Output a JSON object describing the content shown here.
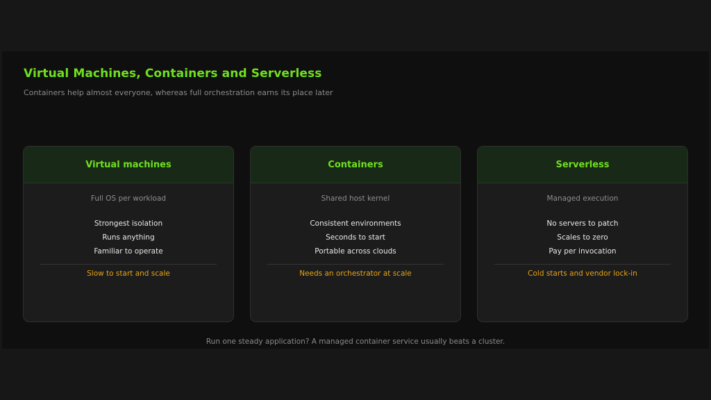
{
  "title": "Virtual Machines, Containers and Serverless",
  "subtitle": "Containers help almost everyone, whereas full orchestration earns its place later",
  "cards": [
    {
      "title": "Virtual machines",
      "subtitle": "Full OS per workload",
      "features": [
        "Strongest isolation",
        "Runs anything",
        "Familiar to operate"
      ],
      "drawback": "Slow to start and scale"
    },
    {
      "title": "Containers",
      "subtitle": "Shared host kernel",
      "features": [
        "Consistent environments",
        "Seconds to start",
        "Portable across clouds"
      ],
      "drawback": "Needs an orchestrator at scale"
    },
    {
      "title": "Serverless",
      "subtitle": "Managed execution",
      "features": [
        "No servers to patch",
        "Scales to zero",
        "Pay per invocation"
      ],
      "drawback": "Cold starts and vendor lock-in"
    }
  ],
  "footer": "Run one steady application? A managed container service usually beats a cluster.",
  "colors": {
    "accent": "#6fe01f",
    "warning": "#e8a317",
    "card_header": "#182917",
    "background": "#0f0f0f"
  }
}
